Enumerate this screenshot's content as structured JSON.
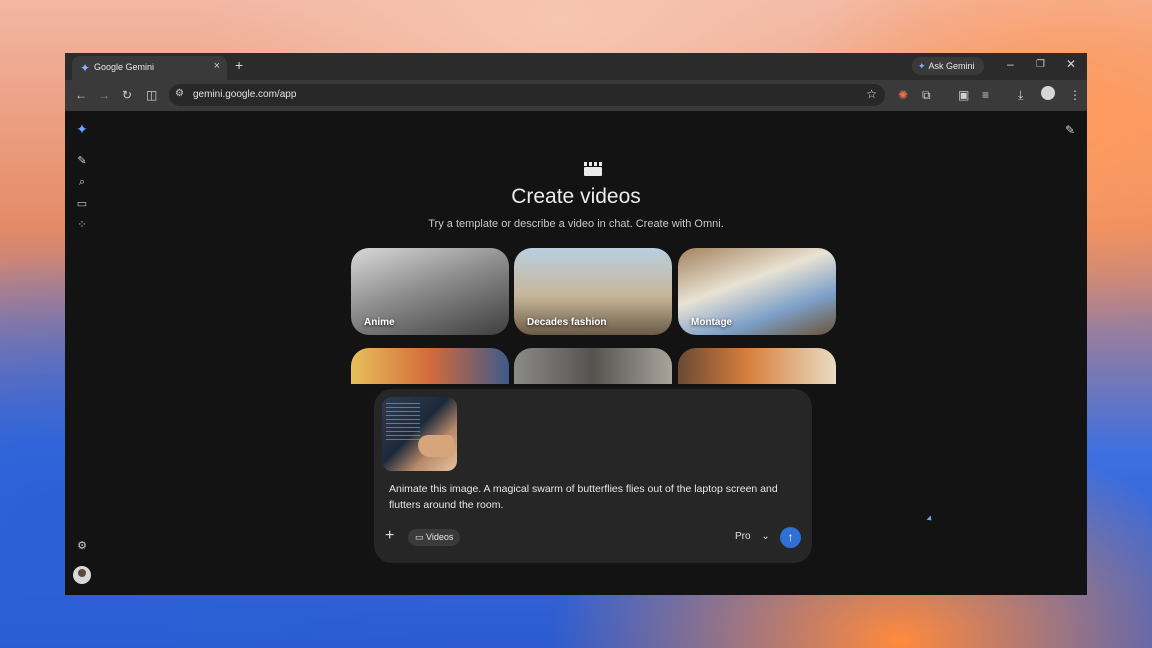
{
  "browser": {
    "tab_title": "Google Gemini",
    "tab_close": "×",
    "new_tab": "+",
    "ask_gemini_label": "Ask Gemini",
    "url": "gemini.google.com/app",
    "window_controls": [
      "–",
      "❐",
      "✕"
    ]
  },
  "page": {
    "heading": "Create videos",
    "subheading": "Try a template or describe a video in chat. Create with Omni."
  },
  "templates": [
    {
      "label": "Anime"
    },
    {
      "label": "Decades fashion"
    },
    {
      "label": "Montage"
    },
    {
      "label": ""
    },
    {
      "label": ""
    },
    {
      "label": ""
    }
  ],
  "composer": {
    "prompt_text": "Animate this image. A magical swarm of butterflies flies out of the laptop screen and flutters around the room.",
    "tool_chip": "Videos",
    "model": "Pro",
    "model_caret": "⌄",
    "send_icon": "↑",
    "plus_icon": "+"
  },
  "icons": {
    "gemini_logo": "✦",
    "sidebar": [
      "edit-icon",
      "search-icon",
      "gems-icon",
      "apps-icon",
      "settings-icon"
    ]
  }
}
